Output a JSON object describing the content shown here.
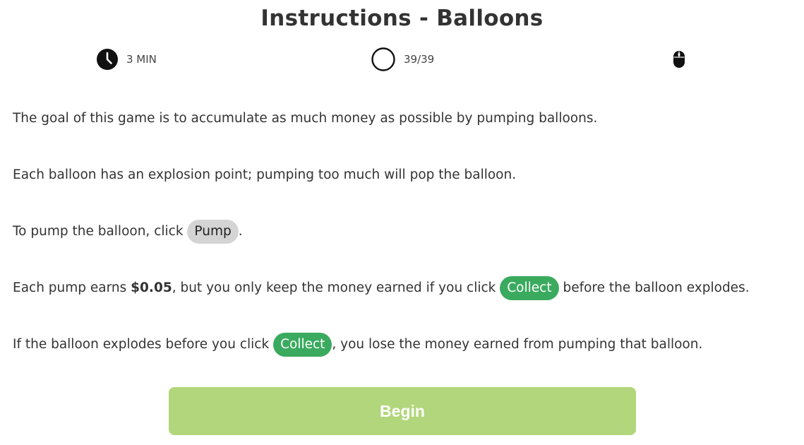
{
  "header": {
    "title": "Instructions - Balloons"
  },
  "stats": {
    "time": {
      "icon": "clock-icon",
      "label": "3 MIN"
    },
    "progress": {
      "icon": "circle-icon",
      "label": "39/39"
    },
    "input": {
      "icon": "mouse-icon"
    }
  },
  "instructions": {
    "p1": "The goal of this game is to accumulate as much money as possible by pumping balloons.",
    "p2": "Each balloon has an explosion point; pumping too much will pop the balloon.",
    "p3_before": "To pump the balloon, click ",
    "p3_pill": "Pump",
    "p3_after": ".",
    "p4_before": "Each pump earns ",
    "p4_amount": "$0.05",
    "p4_middle": ", but you only keep the money earned if you click ",
    "p4_pill": "Collect",
    "p4_after": " before the balloon explodes.",
    "p5_before": "If the balloon explodes before you click ",
    "p5_pill": "Collect",
    "p5_after": ", you lose the money earned from pumping that balloon."
  },
  "actions": {
    "begin_label": "Begin"
  },
  "colors": {
    "collect_green": "#3aaa5e",
    "pump_gray": "#d4d4d4",
    "begin_green": "#b2d67b"
  }
}
